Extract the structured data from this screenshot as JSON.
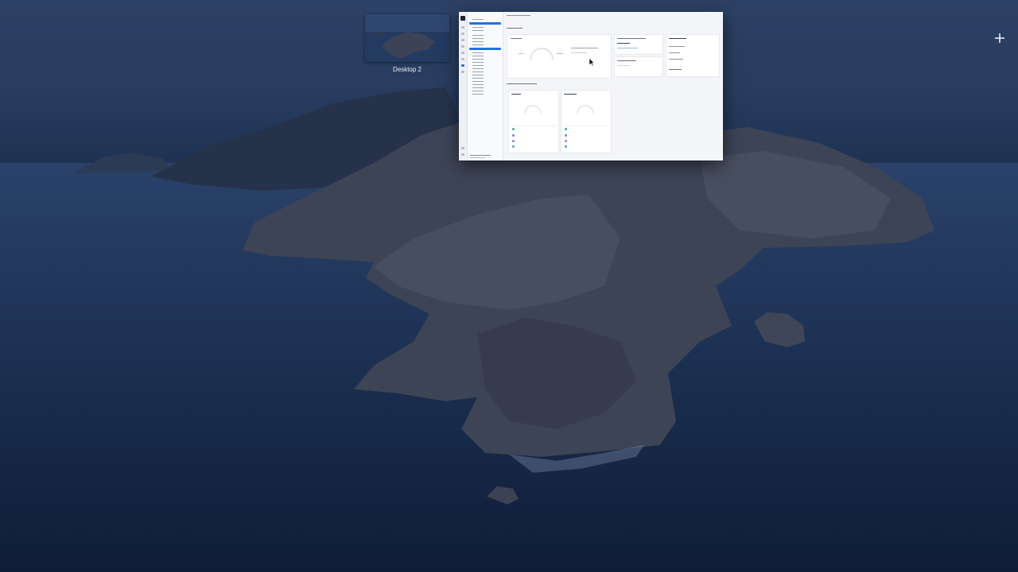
{
  "colors": {
    "accent": "#1e73e8",
    "sky": "#2b3f63",
    "sea": "#1a2d4d"
  },
  "mission_control": {
    "desktop_label": "Desktop 2",
    "add_space_icon": "plus-icon"
  },
  "window": {
    "app_icon": "app-logo-icon"
  }
}
